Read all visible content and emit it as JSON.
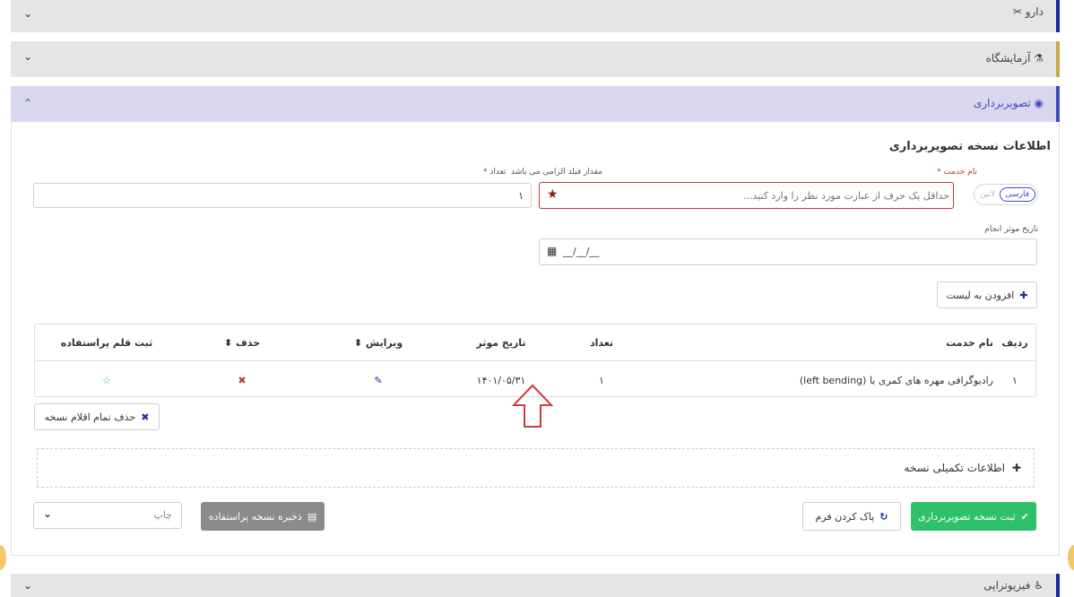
{
  "accordions": {
    "drug": {
      "label": "دارو",
      "icon": "pills-icon"
    },
    "lab": {
      "label": "آزمایشگاه",
      "icon": "flask-icon"
    },
    "imaging": {
      "label": "تصویربرداری",
      "icon": "xray-icon"
    },
    "physio": {
      "label": "فیزیوتراپی",
      "icon": "physio-icon"
    }
  },
  "form": {
    "section_title": "اطلاعات نسخه تصویربرداری",
    "service_label": "نام خدمت *",
    "lang_farsi": "فارسی",
    "lang_latin": "لاتین",
    "service_placeholder": "حداقل یک حرف از عبارت مورد نظر را وارد کنید...",
    "required_note": "مقدار فیلد الزامی می باشد",
    "count_label": "تعداد *",
    "count_value": "۱",
    "date_label": "تاریخ موثر انجام",
    "date_value": "__/__/__",
    "add_button": "افزودن به لیست"
  },
  "table": {
    "headers": {
      "row": "ردیف",
      "service": "نام خدمت",
      "count": "تعداد",
      "date": "تاریخ موثر",
      "edit": "ویرایش ⬍",
      "delete": "حذف ⬍",
      "favorite": "ثبت قلم پراستفاده"
    },
    "rows": [
      {
        "row": "۱",
        "service": "رادیوگرافی مهره های کمری با (left bending)",
        "count": "۱",
        "date": "۱۴۰۱/۰۵/۳۱"
      }
    ]
  },
  "actions": {
    "delete_all": "حذف تمام اقلام نسخه",
    "extra_info": "اطلاعات تکمیلی نسخه",
    "submit": "ثبت نسخه تصویربرداری",
    "clear": "پاک کردن فرم",
    "save_favorite": "ذخیره نسخه پراستفاده",
    "print_select": "چاپ"
  },
  "colors": {
    "accent_blue": "#3d4ac0",
    "success_green": "#2ec06a",
    "danger_red": "#c0393b",
    "annotation_arrow": "#d23a3a"
  }
}
